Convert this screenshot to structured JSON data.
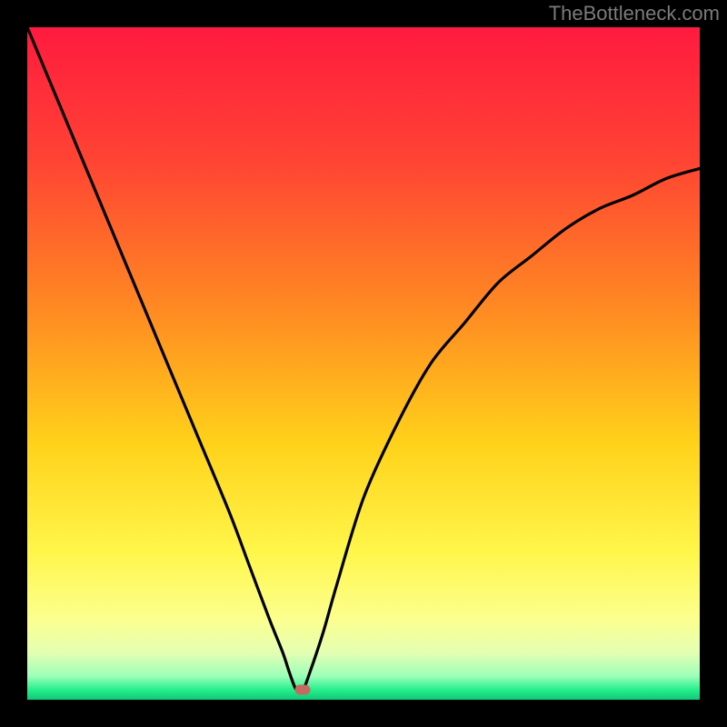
{
  "watermark": "TheBottleneck.com",
  "chart_data": {
    "type": "line",
    "title": "",
    "xlabel": "",
    "ylabel": "",
    "xlim": [
      0,
      100
    ],
    "ylim": [
      0,
      100
    ],
    "grid": false,
    "legend": false,
    "gradient_stops": [
      {
        "pct": 0,
        "color": "#ff1a3f"
      },
      {
        "pct": 20,
        "color": "#ff4433"
      },
      {
        "pct": 42,
        "color": "#ff8a22"
      },
      {
        "pct": 62,
        "color": "#ffd21a"
      },
      {
        "pct": 78,
        "color": "#fff64a"
      },
      {
        "pct": 88,
        "color": "#fcff8e"
      },
      {
        "pct": 93,
        "color": "#e4ffb2"
      },
      {
        "pct": 96.5,
        "color": "#9cffb9"
      },
      {
        "pct": 98.5,
        "color": "#27ef8e"
      },
      {
        "pct": 100,
        "color": "#0fc876"
      }
    ],
    "optimum": {
      "x": 41,
      "y": 98.5
    },
    "series": [
      {
        "name": "bottleneck-curve",
        "x": [
          0,
          5,
          10,
          15,
          20,
          25,
          30,
          33,
          36,
          38,
          39,
          40,
          41,
          42,
          44,
          46,
          50,
          55,
          60,
          65,
          70,
          75,
          80,
          85,
          90,
          95,
          100
        ],
        "values": [
          100,
          88,
          76,
          64,
          52,
          40,
          28,
          20,
          12,
          7,
          4,
          1.5,
          1.5,
          4,
          10,
          17,
          30,
          41,
          50,
          56,
          62,
          66,
          70,
          73,
          75,
          77.5,
          79
        ]
      }
    ]
  }
}
